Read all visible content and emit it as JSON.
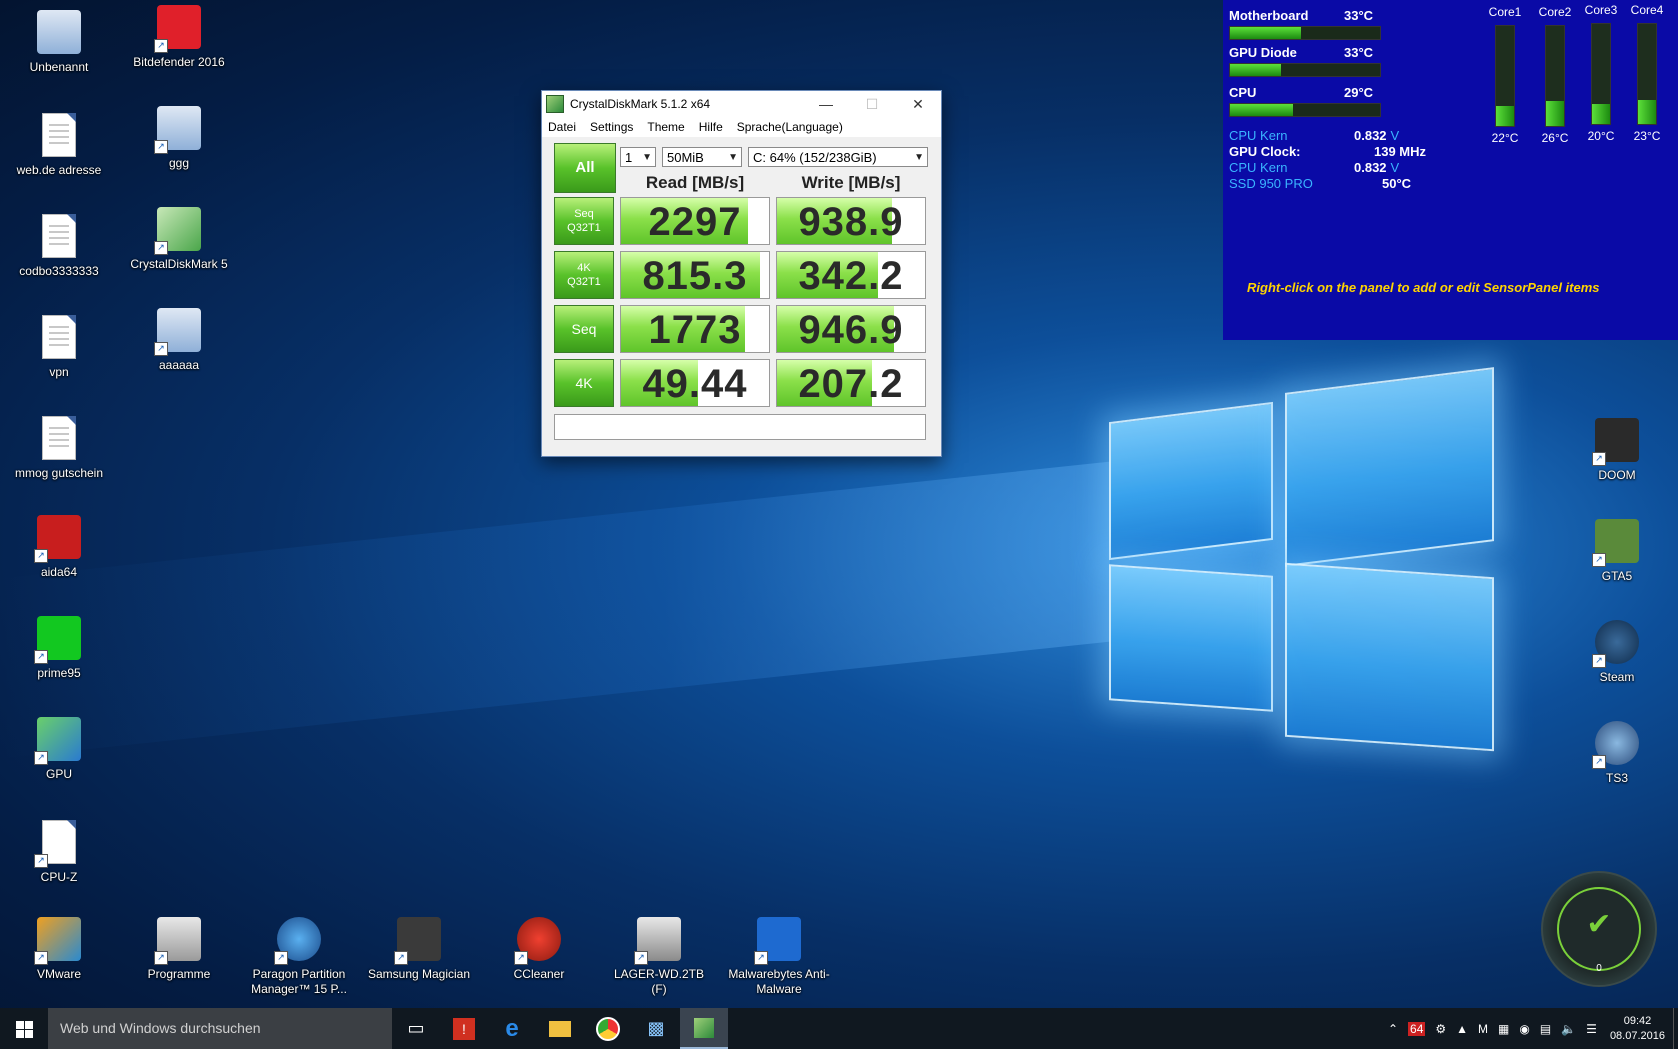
{
  "desktop": {
    "icons_left": [
      {
        "label": "Unbenannt",
        "icon": "window-icon"
      },
      {
        "label": "web.de adresse",
        "icon": "text-document-icon"
      },
      {
        "label": "codbo3333333",
        "icon": "text-document-icon"
      },
      {
        "label": "vpn",
        "icon": "text-document-icon"
      },
      {
        "label": "mmog gutschein",
        "icon": "text-document-icon"
      },
      {
        "label": "aida64",
        "icon": "aida64-icon"
      },
      {
        "label": "prime95",
        "icon": "prime95-icon"
      },
      {
        "label": "GPU",
        "icon": "gpu-icon"
      },
      {
        "label": "CPU-Z",
        "icon": "blank-document-icon"
      }
    ],
    "icons_second": [
      {
        "label": "Bitdefender 2016",
        "icon": "bitdefender-icon"
      },
      {
        "label": "ggg",
        "icon": "window-icon"
      },
      {
        "label": "CrystalDiskMark 5",
        "icon": "crystaldiskmark-icon"
      },
      {
        "label": "aaaaaa",
        "icon": "window-icon"
      }
    ],
    "icons_bottom": [
      {
        "label": "VMware",
        "icon": "vmware-icon"
      },
      {
        "label": "Programme",
        "icon": "folder-icon"
      },
      {
        "label": "Paragon Partition Manager™ 15 P...",
        "icon": "paragon-icon"
      },
      {
        "label": "Samsung Magician",
        "icon": "samsung-ssd-icon"
      },
      {
        "label": "CCleaner",
        "icon": "ccleaner-icon"
      },
      {
        "label": "LAGER-WD.2TB (F)",
        "icon": "drive-icon"
      },
      {
        "label": "Malwarebytes Anti-Malware",
        "icon": "malwarebytes-icon"
      }
    ],
    "icons_right": [
      {
        "label": "DOOM",
        "icon": "doom-icon"
      },
      {
        "label": "GTA5",
        "icon": "gta5-icon"
      },
      {
        "label": "Steam",
        "icon": "steam-icon"
      },
      {
        "label": "TS3",
        "icon": "teamspeak-icon"
      }
    ]
  },
  "cdm": {
    "title": "CrystalDiskMark 5.1.2 x64",
    "menu": [
      "Datei",
      "Settings",
      "Theme",
      "Hilfe",
      "Sprache(Language)"
    ],
    "all_label": "All",
    "count": "1",
    "size": "50MiB",
    "drive": "C: 64% (152/238GiB)",
    "read_header": "Read [MB/s]",
    "write_header": "Write [MB/s]",
    "rows": [
      {
        "label1": "Seq",
        "label2": "Q32T1",
        "read": "2297",
        "write": "938.9",
        "read_fill": 0.86,
        "write_fill": 0.78
      },
      {
        "label1": "4K",
        "label2": "Q32T1",
        "read": "815.3",
        "write": "342.2",
        "read_fill": 0.94,
        "write_fill": 0.68
      },
      {
        "label1": "Seq",
        "label2": "",
        "read": "1773",
        "write": "946.9",
        "read_fill": 0.84,
        "write_fill": 0.79
      },
      {
        "label1": "4K",
        "label2": "",
        "read": "49.44",
        "write": "207.2",
        "read_fill": 0.52,
        "write_fill": 0.64
      }
    ]
  },
  "sensor": {
    "motherboard": {
      "label": "Motherboard",
      "value": "33°C",
      "fill": 0.47
    },
    "gpu_diode": {
      "label": "GPU Diode",
      "value": "33°C",
      "fill": 0.34
    },
    "cpu": {
      "label": "CPU",
      "value": "29°C",
      "fill": 0.42
    },
    "lines": [
      {
        "key": "CPU Kern",
        "value": "0.832",
        "unit": "V",
        "cyan": true
      },
      {
        "key": "GPU Clock:",
        "value": "139 MHz",
        "unit": "",
        "cyan": false
      },
      {
        "key": "CPU Kern",
        "value": "0.832",
        "unit": "V",
        "cyan": true
      },
      {
        "key": "SSD 950 PRO",
        "value": "50°C",
        "unit": "",
        "cyan": true
      }
    ],
    "cores": [
      {
        "label": "Core1",
        "temp": "22°C",
        "fill": 0.2
      },
      {
        "label": "Core2",
        "temp": "26°C",
        "fill": 0.25
      },
      {
        "label": "Core3",
        "temp": "20°C",
        "fill": 0.2
      },
      {
        "label": "Core4",
        "temp": "23°C",
        "fill": 0.24
      }
    ],
    "hint": "Right-click on the panel to add or edit SensorPanel items"
  },
  "taskbar": {
    "search_placeholder": "Web und Windows durchsuchen",
    "time": "09:42",
    "date": "08.07.2016"
  },
  "gauge": {
    "value": "0"
  }
}
